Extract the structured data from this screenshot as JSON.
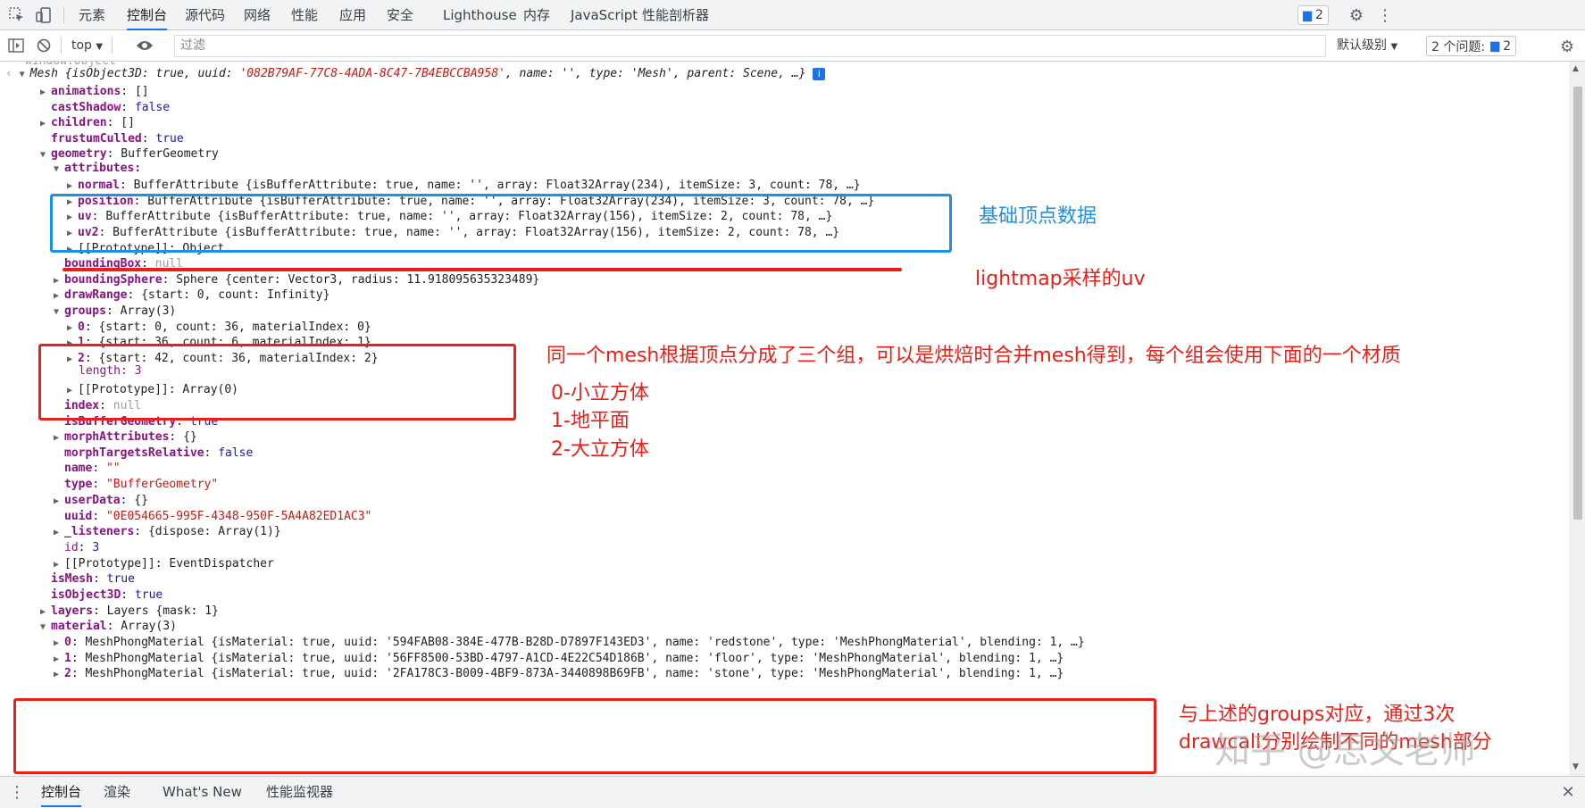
{
  "devtools": {
    "tabs": [
      "元素",
      "控制台",
      "源代码",
      "网络",
      "性能",
      "应用",
      "安全",
      "Lighthouse",
      "内存",
      "JavaScript 性能剖析器"
    ],
    "issues_count": "2",
    "context": "top",
    "filter_placeholder": "过滤",
    "level": "默认级别",
    "issues_label": "2 个问题:",
    "issues_label_count": "2"
  },
  "console": {
    "cut_line": "window.Object",
    "root_summary_prefix": "Mesh {isObject3D: true, uuid: ",
    "root_uuid": "'082B79AF-77C8-4ADA-8C47-7B4EBCCBA958'",
    "root_summary_suffix": ", name: '', type: 'Mesh', parent: Scene, …}",
    "props": {
      "animations": "[]",
      "castShadow": "false",
      "children": "[]",
      "frustumCulled": "true",
      "geometry": "BufferGeometry",
      "attributes_label": "attributes:",
      "normal": "BufferAttribute {isBufferAttribute: true, name: '', array: Float32Array(234), itemSize: 3, count: 78, …}",
      "position": "BufferAttribute {isBufferAttribute: true, name: '', array: Float32Array(234), itemSize: 3, count: 78, …}",
      "uv": "BufferAttribute {isBufferAttribute: true, name: '', array: Float32Array(156), itemSize: 2, count: 78, …}",
      "uv2": "BufferAttribute {isBufferAttribute: true, name: '', array: Float32Array(156), itemSize: 2, count: 78, …}",
      "attr_proto": "[[Prototype]]: Object",
      "boundingBox": "null",
      "boundingSphere": "Sphere {center: Vector3, radius: 11.918095635323489}",
      "drawRange": "{start: 0, count: Infinity}",
      "groups": "Array(3)",
      "group0": "{start: 0, count: 36, materialIndex: 0}",
      "group1": "{start: 36, count: 6, materialIndex: 1}",
      "group2": "{start: 42, count: 36, materialIndex: 2}",
      "length": "length: 3",
      "groups_proto": "[[Prototype]]: Array(0)",
      "index": "null",
      "isBufferGeometry": "true",
      "morphAttributes": "{}",
      "morphTargetsRelative": "false",
      "name_val": "\"\"",
      "type_val": "\"BufferGeometry\"",
      "userData": "{}",
      "uuid_val": "\"0E054665-995F-4348-950F-5A4A82ED1AC3\"",
      "listeners": "{dispose: Array(1)}",
      "id_val": "3",
      "geom_proto": "[[Prototype]]: EventDispatcher",
      "isMesh": "true",
      "isObject3D": "true",
      "layers": "Layers {mask: 1}",
      "material": "Array(3)",
      "mat0": "MeshPhongMaterial {isMaterial: true, uuid: '594FAB08-384E-477B-B28D-D7897F143ED3', name: 'redstone', type: 'MeshPhongMaterial', blending: 1, …}",
      "mat1": "MeshPhongMaterial {isMaterial: true, uuid: '56FF8500-53BD-4797-A1CD-4E22C54D186B', name: 'floor', type: 'MeshPhongMaterial', blending: 1, …}",
      "mat2": "MeshPhongMaterial {isMaterial: true, uuid: '2FA178C3-B009-4BF9-873A-3440898B69FB', name: 'stone', type: 'MeshPhongMaterial', blending: 1, …}"
    }
  },
  "annotations": {
    "base_vertex": "基础顶点数据",
    "lightmap_uv": "lightmap采样的uv",
    "groups_note": "同一个mesh根据顶点分成了三个组，可以是烘焙时合并mesh得到，每个组会使用下面的一个材质",
    "g0": "0-小立方体",
    "g1": "1-地平面",
    "g2": "2-大立方体",
    "mat_note_1": "与上述的groups对应，通过3次",
    "mat_note_2": "drawcall分别绘制不同的mesh部分",
    "colors": {
      "blue": "#1e90e6",
      "red": "#e8201a"
    }
  },
  "watermark": "知乎 @思文老师",
  "drawer": {
    "tabs": [
      "控制台",
      "渲染",
      "What's New",
      "性能监视器"
    ]
  }
}
